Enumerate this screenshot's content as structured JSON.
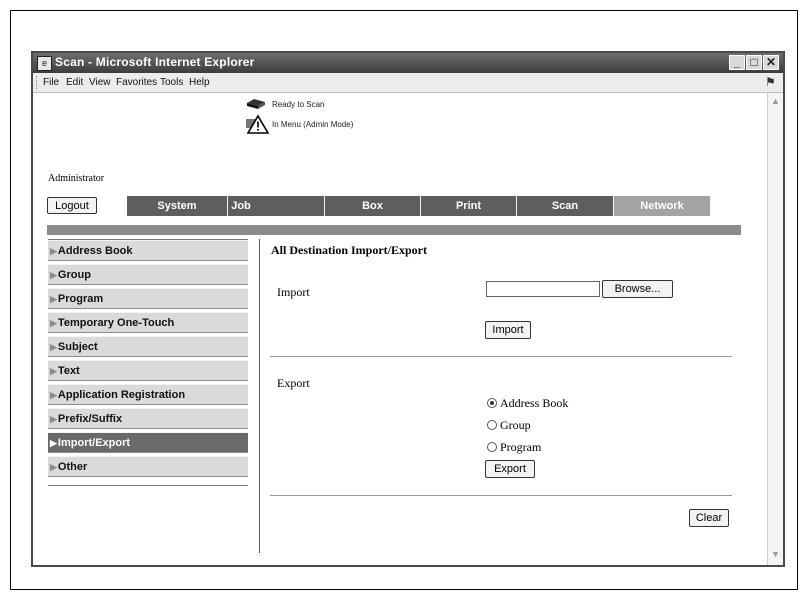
{
  "window": {
    "title": "Scan - Microsoft Internet Explorer",
    "menu": [
      "File",
      "Edit",
      "View",
      "Favorites",
      "Tools",
      "Help"
    ],
    "controls": [
      "minimize-icon",
      "maximize-icon",
      "close-icon"
    ]
  },
  "status": {
    "ready": "Ready to Scan",
    "mode": "In Menu (Admin Mode)"
  },
  "user": {
    "label": "Administrator"
  },
  "header": {
    "logout": "Logout",
    "tabs": [
      "System",
      "Job",
      "Box",
      "Print",
      "Scan",
      "Network"
    ]
  },
  "sidebar": {
    "items": [
      {
        "label": "Address Book"
      },
      {
        "label": "Group"
      },
      {
        "label": "Program"
      },
      {
        "label": "Temporary One-Touch"
      },
      {
        "label": "Subject"
      },
      {
        "label": "Text"
      },
      {
        "label": "Application Registration"
      },
      {
        "label": "Prefix/Suffix"
      },
      {
        "label": "Import/Export",
        "active": true
      },
      {
        "label": "Other"
      }
    ]
  },
  "main": {
    "title": "All Destination Import/Export",
    "import": {
      "label": "Import",
      "file_value": "",
      "browse": "Browse...",
      "button": "Import"
    },
    "export": {
      "label": "Export",
      "options": [
        "Address Book",
        "Group",
        "Program"
      ],
      "selected": "Address Book",
      "button": "Export"
    },
    "clear": "Clear"
  },
  "colors": {
    "tab_dark": "#5e5e5e",
    "tab_light": "#a3a3a3",
    "sidebar_active": "#6a6a6a",
    "band": "#8c8c8c"
  }
}
